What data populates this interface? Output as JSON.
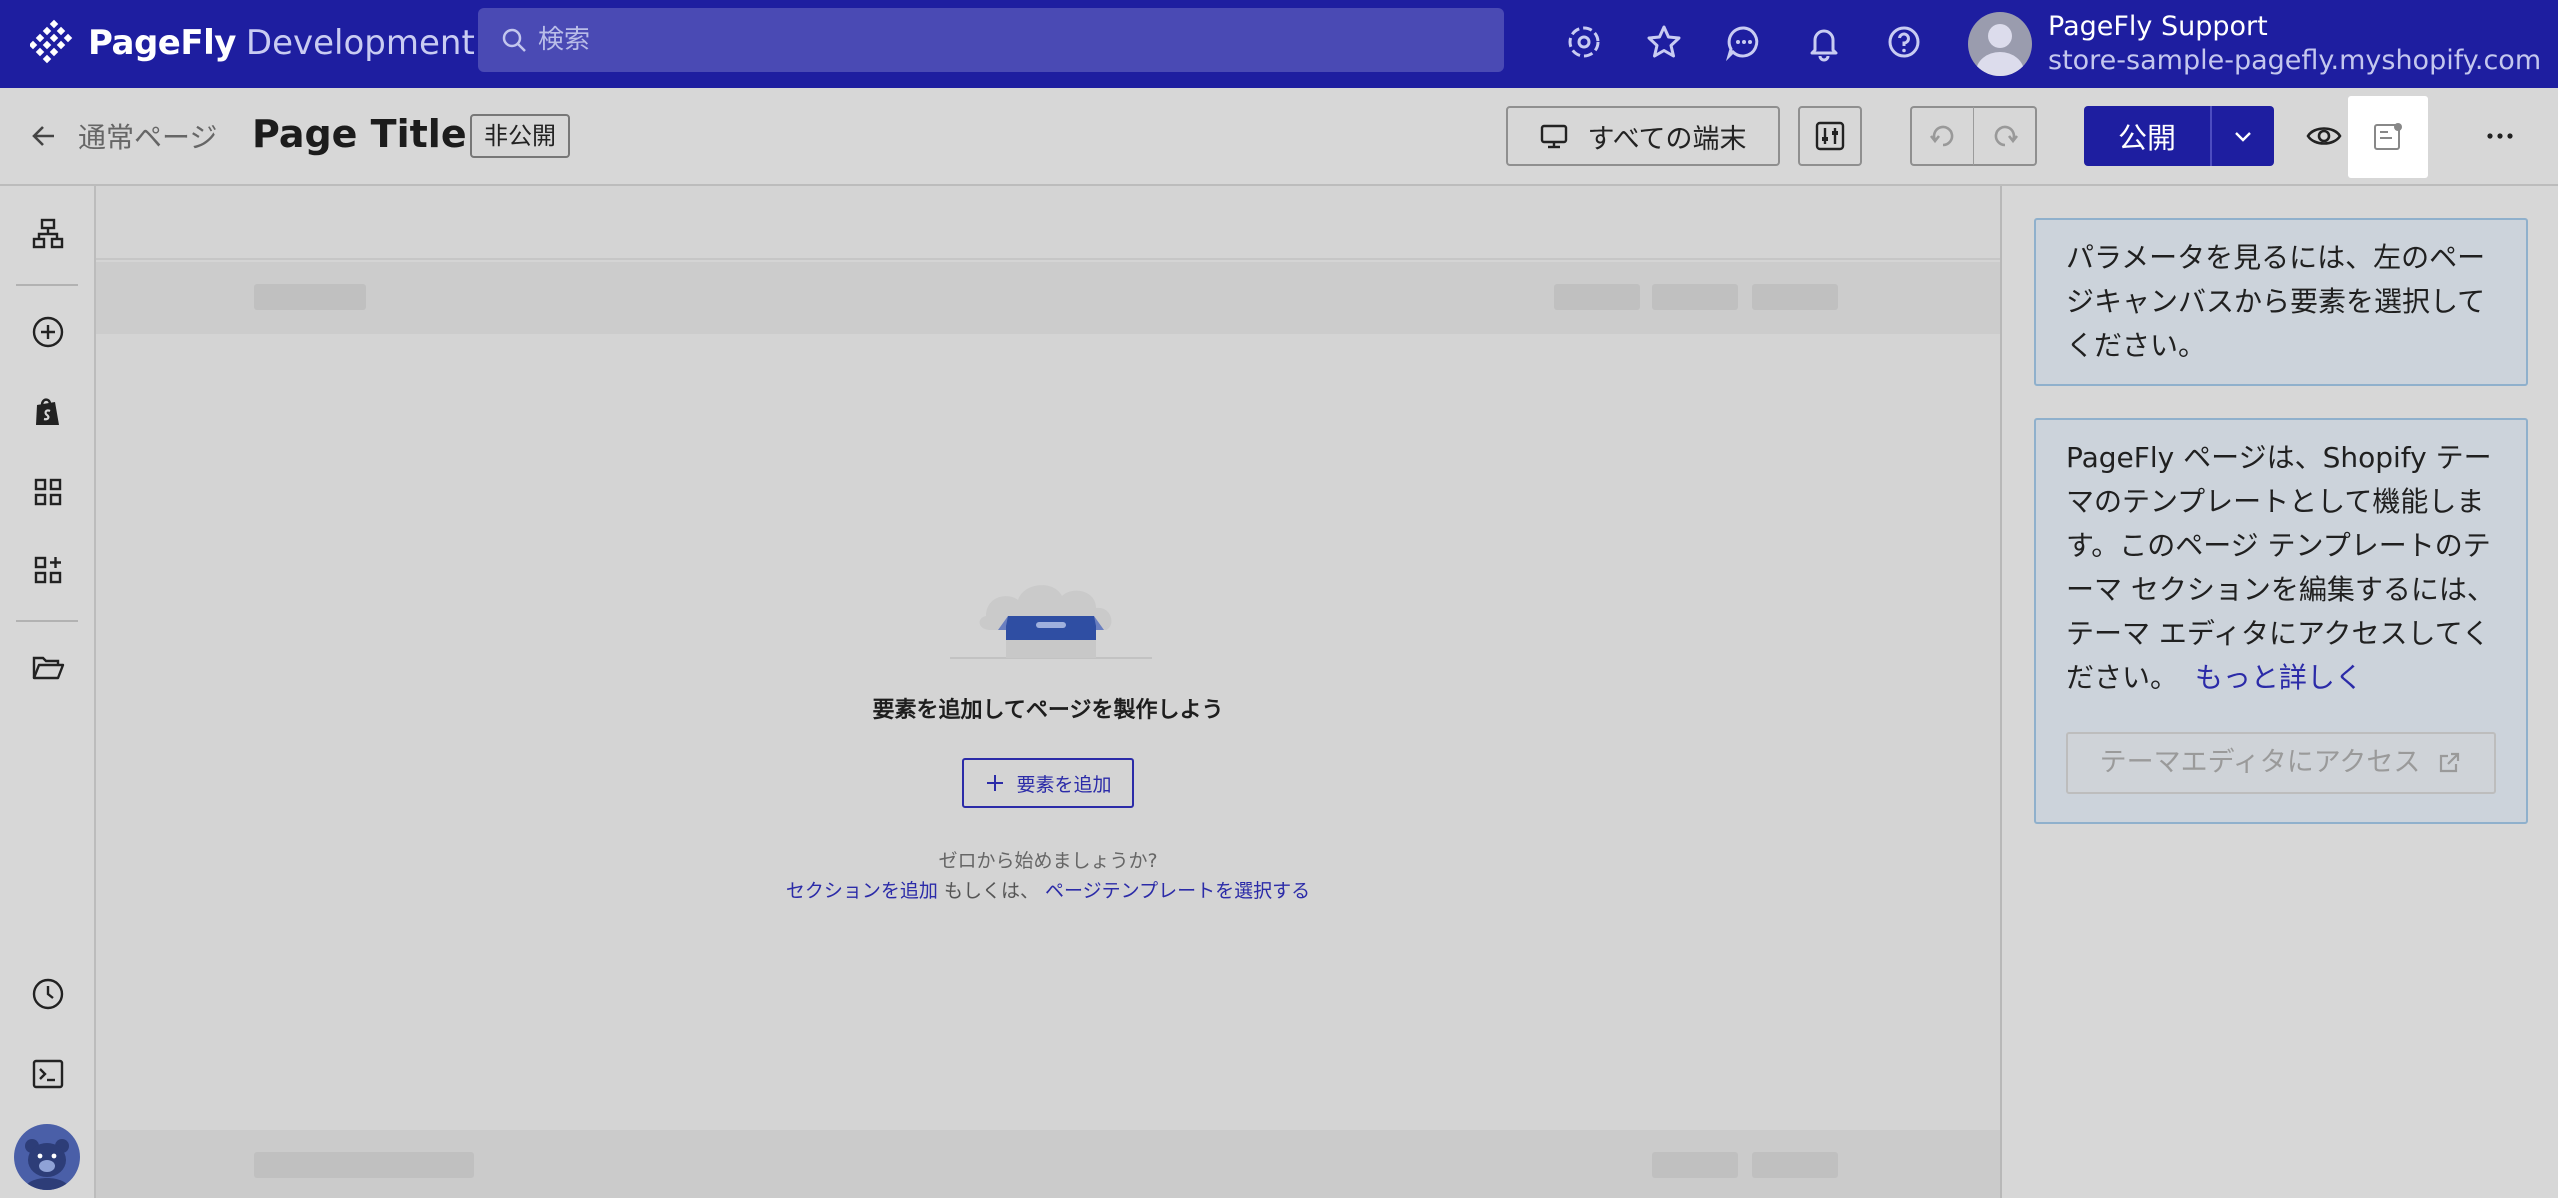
{
  "app": {
    "brand": "PageFly",
    "environment": "Development",
    "search_placeholder": "検索",
    "account": {
      "user": "PageFly Support",
      "store": "store-sample-pagefly.myshopify.com"
    },
    "topbar_icons": [
      "settings-gear-icon",
      "star-icon",
      "chat-icon",
      "bell-icon",
      "help-icon"
    ]
  },
  "toolbar": {
    "back_label": "通常ページ",
    "page_title": "Page Title",
    "status": "非公開",
    "device_label": "すべての端末",
    "publish_label": "公開"
  },
  "rail": {
    "icons": [
      "layers-icon",
      "add-circle-icon",
      "shopify-bag-icon",
      "grid-icon",
      "add-grid-icon",
      "folder-open-icon",
      "history-clock-icon",
      "terminal-icon"
    ]
  },
  "canvas": {
    "empty_title": "要素を追加してページを製作しよう",
    "add_element": "要素を追加",
    "hint": "ゼロから始めましょうか?",
    "add_section": "セクションを追加",
    "or_text": "もしくは、",
    "choose_template": "ページテンプレートを選択する"
  },
  "panel": {
    "select_hint": "パラメータを見るには、左のページキャンバスから要素を選択してください。",
    "theme_note": "PageFly ページは、Shopify テーマのテンプレートとして機能します。このページ テンプレートのテーマ セクションを編集するには、テーマ エディタにアクセスしてください。",
    "learn_more": "もっと詳しく",
    "theme_editor_button": "テーマエディタにアクセス"
  },
  "colors": {
    "brand": "#1e1ea0",
    "link": "#2b2ba8",
    "overlay": "#d6d6d6"
  }
}
